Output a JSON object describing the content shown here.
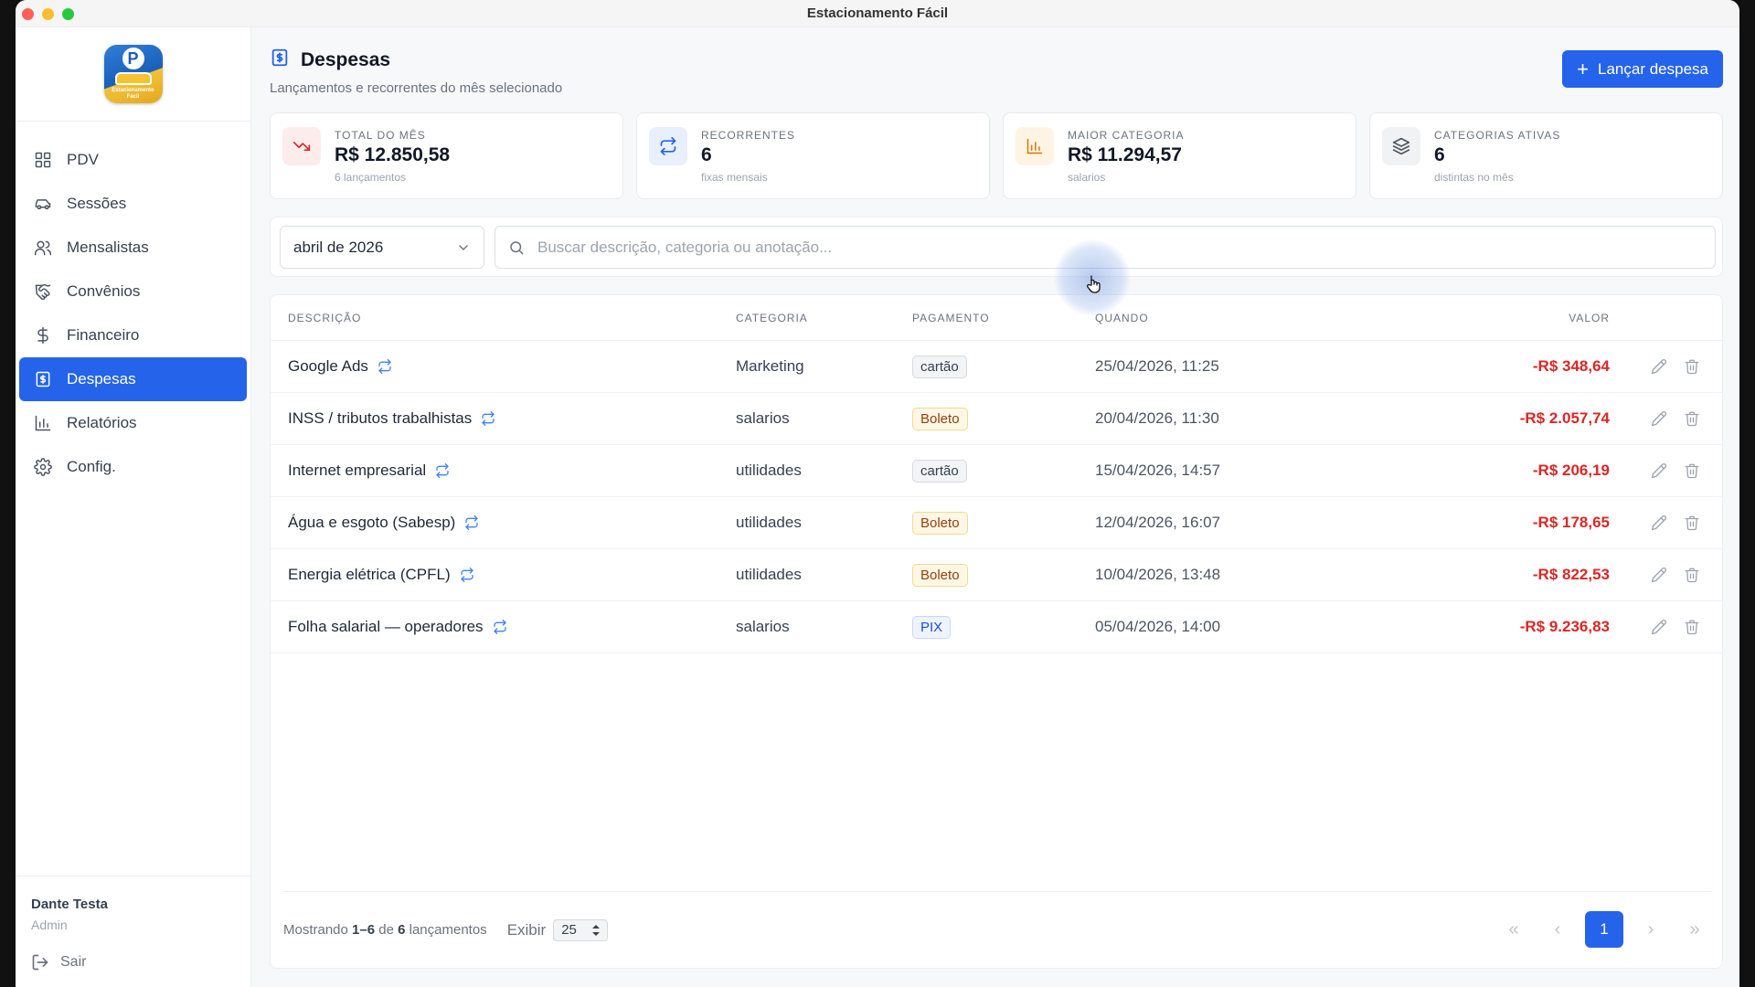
{
  "window": {
    "title": "Estacionamento Fácil"
  },
  "sidebar": {
    "logo_text": "Estacionamento Fácil",
    "items": [
      {
        "label": "PDV",
        "icon": "grid-icon",
        "active": false
      },
      {
        "label": "Sessões",
        "icon": "car-icon",
        "active": false
      },
      {
        "label": "Mensalistas",
        "icon": "users-icon",
        "active": false
      },
      {
        "label": "Convênios",
        "icon": "handshake-icon",
        "active": false
      },
      {
        "label": "Financeiro",
        "icon": "dollar-icon",
        "active": false
      },
      {
        "label": "Despesas",
        "icon": "receipt-icon",
        "active": true
      },
      {
        "label": "Relatórios",
        "icon": "bar-chart-icon",
        "active": false
      },
      {
        "label": "Config.",
        "icon": "gear-icon",
        "active": false
      }
    ],
    "user": {
      "name": "Dante Testa",
      "role": "Admin"
    },
    "logout_label": "Sair"
  },
  "header": {
    "title": "Despesas",
    "subtitle": "Lançamentos e recorrentes do mês selecionado",
    "primary_button": "Lançar despesa"
  },
  "stats": [
    {
      "label": "TOTAL DO MÊS",
      "value": "R$ 12.850,58",
      "foot": "6 lançamentos",
      "icon": "trending-down-icon",
      "color": "#dc2626",
      "bg": "#fdecec"
    },
    {
      "label": "RECORRENTES",
      "value": "6",
      "foot": "fixas mensais",
      "icon": "repeat-icon",
      "color": "#2563eb",
      "bg": "#e8effd"
    },
    {
      "label": "MAIOR CATEGORIA",
      "value": "R$ 11.294,57",
      "foot": "salarios",
      "icon": "bar-chart-icon",
      "color": "#d97706",
      "bg": "#fdf4e3"
    },
    {
      "label": "CATEGORIAS ATIVAS",
      "value": "6",
      "foot": "distintas no mês",
      "icon": "layers-icon",
      "color": "#4b5563",
      "bg": "#f1f2f4"
    }
  ],
  "filters": {
    "month": "abril de 2026",
    "search_placeholder": "Buscar descrição, categoria ou anotação..."
  },
  "table": {
    "columns": [
      "DESCRIÇÃO",
      "CATEGORIA",
      "PAGAMENTO",
      "QUANDO",
      "VALOR"
    ],
    "rows": [
      {
        "desc": "Google Ads",
        "cat": "Marketing",
        "pay": "cartão",
        "when": "25/04/2026, 11:25",
        "val": "-R$ 348,64"
      },
      {
        "desc": "INSS / tributos trabalhistas",
        "cat": "salarios",
        "pay": "Boleto",
        "when": "20/04/2026, 11:30",
        "val": "-R$ 2.057,74"
      },
      {
        "desc": "Internet empresarial",
        "cat": "utilidades",
        "pay": "cartão",
        "when": "15/04/2026, 14:57",
        "val": "-R$ 206,19"
      },
      {
        "desc": "Água e esgoto (Sabesp)",
        "cat": "utilidades",
        "pay": "Boleto",
        "when": "12/04/2026, 16:07",
        "val": "-R$ 178,65"
      },
      {
        "desc": "Energia elétrica (CPFL)",
        "cat": "utilidades",
        "pay": "Boleto",
        "when": "10/04/2026, 13:48",
        "val": "-R$ 822,53"
      },
      {
        "desc": "Folha salarial — operadores",
        "cat": "salarios",
        "pay": "PIX",
        "when": "05/04/2026, 14:00",
        "val": "-R$ 9.236,83"
      }
    ]
  },
  "footer": {
    "showing_prefix": "Mostrando",
    "showing_range": "1–6",
    "showing_of": "de",
    "showing_total": "6",
    "showing_suffix": "lançamentos",
    "per_page_label": "Exibir",
    "per_page": "25",
    "current_page": "1"
  }
}
